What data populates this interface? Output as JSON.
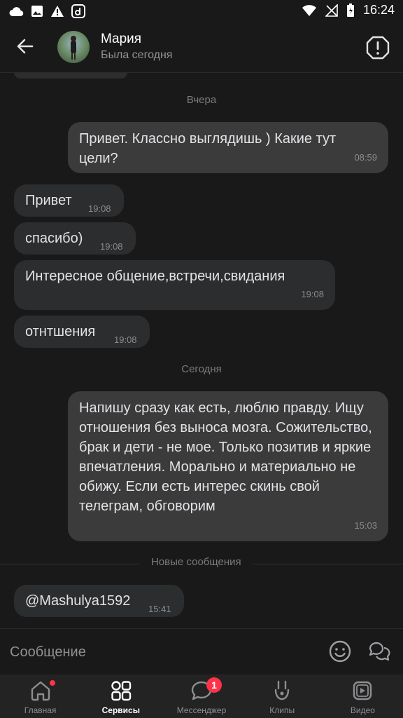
{
  "status_bar": {
    "time": "16:24"
  },
  "header": {
    "back_icon": "arrow-left-icon",
    "name": "Мария",
    "status": "Была сегодня",
    "report_icon": "warning-octagon-icon"
  },
  "messages": {
    "day_yesterday": "Вчера",
    "m1": {
      "text": "Привет. Классно выглядишь ) Какие тут цели?",
      "time": "08:59"
    },
    "m2": {
      "text": "Привет",
      "time": "19:08"
    },
    "m3": {
      "text": "спасибо)",
      "time": "19:08"
    },
    "m4": {
      "text": "Интересное общение,встречи,свидания",
      "time": "19:08"
    },
    "m5": {
      "text": "отнтшения",
      "time": "19:08"
    },
    "day_today": "Сегодня",
    "m6": {
      "text": "Напишу сразу как есть, люблю правду. Ищу отношения без выноса мозга. Сожительство, брак и дети - не мое. Только позитив и яркие впечатления. Морально и материально не обижу. Если есть интерес скинь свой телеграм, обговорим",
      "time": "15:03"
    },
    "new_messages": "Новые сообщения",
    "m7": {
      "text": "@Mashulya1592",
      "time": "15:41"
    }
  },
  "composer": {
    "placeholder": "Сообщение"
  },
  "nav": {
    "home": "Главная",
    "services": "Сервисы",
    "messenger": "Мессенджер",
    "messenger_badge": "1",
    "clips": "Клипы",
    "video": "Видео"
  },
  "colors": {
    "accent_badge": "#ff3347",
    "bubble_in": "#2c2d2e",
    "bubble_out": "#3b3b3c",
    "background": "#19191a"
  }
}
